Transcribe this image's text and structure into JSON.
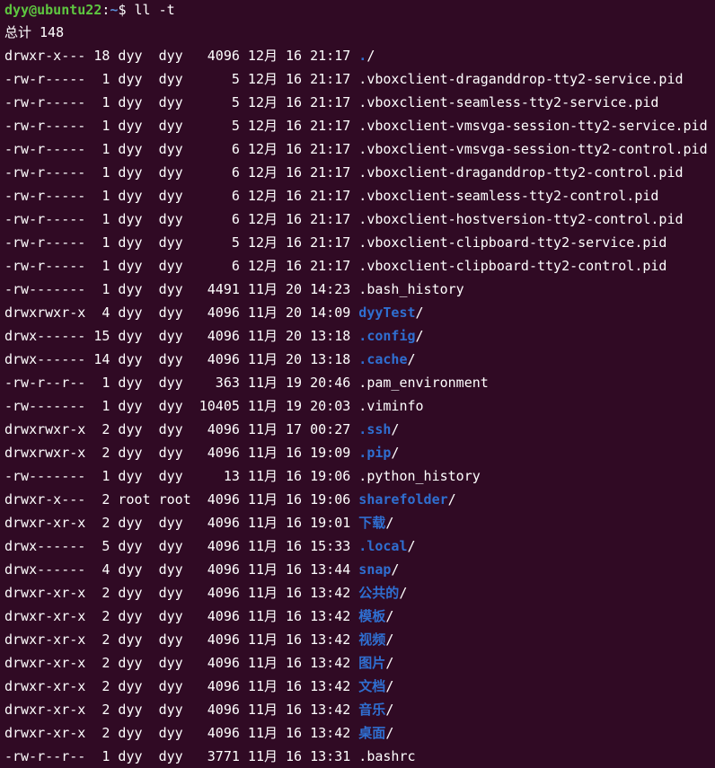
{
  "terminal": {
    "prompt": {
      "user_host": "dyy@ubuntu22",
      "colon": ":",
      "path": "~",
      "symbol": "$ ",
      "command": "ll -t"
    },
    "total_label": "总计 148",
    "colors": {
      "background": "#300a24",
      "text": "#ffffff",
      "prompt_user": "#5ec640",
      "prompt_path": "#5b8dd6",
      "directory": "#2f6fd1"
    },
    "entries": [
      {
        "perms": "drwxr-x---",
        "links": "18",
        "owner": "dyy",
        "group": "dyy",
        "size": "4096",
        "month": "12月",
        "day": "16",
        "time": "21:17",
        "name": ".",
        "is_dir": true
      },
      {
        "perms": "-rw-r-----",
        "links": "1",
        "owner": "dyy",
        "group": "dyy",
        "size": "5",
        "month": "12月",
        "day": "16",
        "time": "21:17",
        "name": ".vboxclient-draganddrop-tty2-service.pid",
        "is_dir": false
      },
      {
        "perms": "-rw-r-----",
        "links": "1",
        "owner": "dyy",
        "group": "dyy",
        "size": "5",
        "month": "12月",
        "day": "16",
        "time": "21:17",
        "name": ".vboxclient-seamless-tty2-service.pid",
        "is_dir": false
      },
      {
        "perms": "-rw-r-----",
        "links": "1",
        "owner": "dyy",
        "group": "dyy",
        "size": "5",
        "month": "12月",
        "day": "16",
        "time": "21:17",
        "name": ".vboxclient-vmsvga-session-tty2-service.pid",
        "is_dir": false
      },
      {
        "perms": "-rw-r-----",
        "links": "1",
        "owner": "dyy",
        "group": "dyy",
        "size": "6",
        "month": "12月",
        "day": "16",
        "time": "21:17",
        "name": ".vboxclient-vmsvga-session-tty2-control.pid",
        "is_dir": false
      },
      {
        "perms": "-rw-r-----",
        "links": "1",
        "owner": "dyy",
        "group": "dyy",
        "size": "6",
        "month": "12月",
        "day": "16",
        "time": "21:17",
        "name": ".vboxclient-draganddrop-tty2-control.pid",
        "is_dir": false
      },
      {
        "perms": "-rw-r-----",
        "links": "1",
        "owner": "dyy",
        "group": "dyy",
        "size": "6",
        "month": "12月",
        "day": "16",
        "time": "21:17",
        "name": ".vboxclient-seamless-tty2-control.pid",
        "is_dir": false
      },
      {
        "perms": "-rw-r-----",
        "links": "1",
        "owner": "dyy",
        "group": "dyy",
        "size": "6",
        "month": "12月",
        "day": "16",
        "time": "21:17",
        "name": ".vboxclient-hostversion-tty2-control.pid",
        "is_dir": false
      },
      {
        "perms": "-rw-r-----",
        "links": "1",
        "owner": "dyy",
        "group": "dyy",
        "size": "5",
        "month": "12月",
        "day": "16",
        "time": "21:17",
        "name": ".vboxclient-clipboard-tty2-service.pid",
        "is_dir": false
      },
      {
        "perms": "-rw-r-----",
        "links": "1",
        "owner": "dyy",
        "group": "dyy",
        "size": "6",
        "month": "12月",
        "day": "16",
        "time": "21:17",
        "name": ".vboxclient-clipboard-tty2-control.pid",
        "is_dir": false
      },
      {
        "perms": "-rw-------",
        "links": "1",
        "owner": "dyy",
        "group": "dyy",
        "size": "4491",
        "month": "11月",
        "day": "20",
        "time": "14:23",
        "name": ".bash_history",
        "is_dir": false
      },
      {
        "perms": "drwxrwxr-x",
        "links": "4",
        "owner": "dyy",
        "group": "dyy",
        "size": "4096",
        "month": "11月",
        "day": "20",
        "time": "14:09",
        "name": "dyyTest",
        "is_dir": true
      },
      {
        "perms": "drwx------",
        "links": "15",
        "owner": "dyy",
        "group": "dyy",
        "size": "4096",
        "month": "11月",
        "day": "20",
        "time": "13:18",
        "name": ".config",
        "is_dir": true
      },
      {
        "perms": "drwx------",
        "links": "14",
        "owner": "dyy",
        "group": "dyy",
        "size": "4096",
        "month": "11月",
        "day": "20",
        "time": "13:18",
        "name": ".cache",
        "is_dir": true
      },
      {
        "perms": "-rw-r--r--",
        "links": "1",
        "owner": "dyy",
        "group": "dyy",
        "size": "363",
        "month": "11月",
        "day": "19",
        "time": "20:46",
        "name": ".pam_environment",
        "is_dir": false
      },
      {
        "perms": "-rw-------",
        "links": "1",
        "owner": "dyy",
        "group": "dyy",
        "size": "10405",
        "month": "11月",
        "day": "19",
        "time": "20:03",
        "name": ".viminfo",
        "is_dir": false
      },
      {
        "perms": "drwxrwxr-x",
        "links": "2",
        "owner": "dyy",
        "group": "dyy",
        "size": "4096",
        "month": "11月",
        "day": "17",
        "time": "00:27",
        "name": ".ssh",
        "is_dir": true
      },
      {
        "perms": "drwxrwxr-x",
        "links": "2",
        "owner": "dyy",
        "group": "dyy",
        "size": "4096",
        "month": "11月",
        "day": "16",
        "time": "19:09",
        "name": ".pip",
        "is_dir": true
      },
      {
        "perms": "-rw-------",
        "links": "1",
        "owner": "dyy",
        "group": "dyy",
        "size": "13",
        "month": "11月",
        "day": "16",
        "time": "19:06",
        "name": ".python_history",
        "is_dir": false
      },
      {
        "perms": "drwxr-x---",
        "links": "2",
        "owner": "root",
        "group": "root",
        "size": "4096",
        "month": "11月",
        "day": "16",
        "time": "19:06",
        "name": "sharefolder",
        "is_dir": true
      },
      {
        "perms": "drwxr-xr-x",
        "links": "2",
        "owner": "dyy",
        "group": "dyy",
        "size": "4096",
        "month": "11月",
        "day": "16",
        "time": "19:01",
        "name": "下载",
        "is_dir": true
      },
      {
        "perms": "drwx------",
        "links": "5",
        "owner": "dyy",
        "group": "dyy",
        "size": "4096",
        "month": "11月",
        "day": "16",
        "time": "15:33",
        "name": ".local",
        "is_dir": true
      },
      {
        "perms": "drwx------",
        "links": "4",
        "owner": "dyy",
        "group": "dyy",
        "size": "4096",
        "month": "11月",
        "day": "16",
        "time": "13:44",
        "name": "snap",
        "is_dir": true
      },
      {
        "perms": "drwxr-xr-x",
        "links": "2",
        "owner": "dyy",
        "group": "dyy",
        "size": "4096",
        "month": "11月",
        "day": "16",
        "time": "13:42",
        "name": "公共的",
        "is_dir": true
      },
      {
        "perms": "drwxr-xr-x",
        "links": "2",
        "owner": "dyy",
        "group": "dyy",
        "size": "4096",
        "month": "11月",
        "day": "16",
        "time": "13:42",
        "name": "模板",
        "is_dir": true
      },
      {
        "perms": "drwxr-xr-x",
        "links": "2",
        "owner": "dyy",
        "group": "dyy",
        "size": "4096",
        "month": "11月",
        "day": "16",
        "time": "13:42",
        "name": "视频",
        "is_dir": true
      },
      {
        "perms": "drwxr-xr-x",
        "links": "2",
        "owner": "dyy",
        "group": "dyy",
        "size": "4096",
        "month": "11月",
        "day": "16",
        "time": "13:42",
        "name": "图片",
        "is_dir": true
      },
      {
        "perms": "drwxr-xr-x",
        "links": "2",
        "owner": "dyy",
        "group": "dyy",
        "size": "4096",
        "month": "11月",
        "day": "16",
        "time": "13:42",
        "name": "文档",
        "is_dir": true
      },
      {
        "perms": "drwxr-xr-x",
        "links": "2",
        "owner": "dyy",
        "group": "dyy",
        "size": "4096",
        "month": "11月",
        "day": "16",
        "time": "13:42",
        "name": "音乐",
        "is_dir": true
      },
      {
        "perms": "drwxr-xr-x",
        "links": "2",
        "owner": "dyy",
        "group": "dyy",
        "size": "4096",
        "month": "11月",
        "day": "16",
        "time": "13:42",
        "name": "桌面",
        "is_dir": true
      },
      {
        "perms": "-rw-r--r--",
        "links": "1",
        "owner": "dyy",
        "group": "dyy",
        "size": "3771",
        "month": "11月",
        "day": "16",
        "time": "13:31",
        "name": ".bashrc",
        "is_dir": false
      }
    ]
  }
}
